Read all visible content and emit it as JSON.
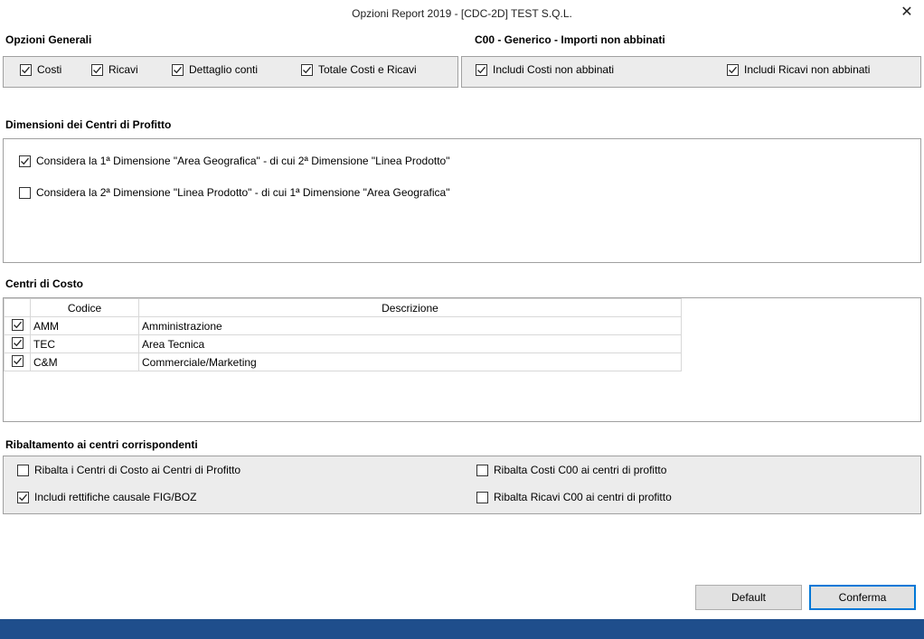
{
  "window": {
    "title": "Opzioni Report 2019 - [CDC-2D] TEST S.Q.L.",
    "close_glyph": "✕"
  },
  "generali": {
    "title": "Opzioni Generali",
    "items": [
      {
        "label": "Costi",
        "checked": true
      },
      {
        "label": "Ricavi",
        "checked": true
      },
      {
        "label": "Dettaglio conti",
        "checked": true
      },
      {
        "label": "Totale Costi e Ricavi",
        "checked": true
      }
    ]
  },
  "c00": {
    "title": "C00 - Generico - Importi non abbinati",
    "items": [
      {
        "label": "Includi Costi non abbinati",
        "checked": true
      },
      {
        "label": "Includi Ricavi non abbinati",
        "checked": true
      }
    ]
  },
  "dimensioni": {
    "title": "Dimensioni dei Centri di Profitto",
    "items": [
      {
        "label": "Considera la 1ª Dimensione \"Area Geografica\" - di cui 2ª Dimensione \"Linea Prodotto\"",
        "checked": true
      },
      {
        "label": "Considera la 2ª Dimensione \"Linea Prodotto\" - di cui 1ª Dimensione \"Area Geografica\"",
        "checked": false
      }
    ]
  },
  "centri": {
    "title": "Centri di Costo",
    "columns": {
      "codice": "Codice",
      "descrizione": "Descrizione"
    },
    "rows": [
      {
        "checked": true,
        "codice": "AMM",
        "descrizione": "Amministrazione"
      },
      {
        "checked": true,
        "codice": "TEC",
        "descrizione": "Area Tecnica"
      },
      {
        "checked": true,
        "codice": "C&M",
        "descrizione": "Commerciale/Marketing"
      }
    ]
  },
  "ribaltamento": {
    "title": "Ribaltamento ai centri corrispondenti",
    "items": [
      {
        "label": "Ribalta i Centri di Costo ai Centri di Profitto",
        "checked": false
      },
      {
        "label": "Ribalta Costi C00 ai centri di profitto",
        "checked": false
      },
      {
        "label": "Includi rettifiche causale FIG/BOZ",
        "checked": true
      },
      {
        "label": "Ribalta Ricavi C00 ai centri di profitto",
        "checked": false
      }
    ]
  },
  "buttons": {
    "default_label": "Default",
    "confirm_label": "Conferma"
  },
  "colors": {
    "footer": "#1f4e8c",
    "panel_gray": "#ececec",
    "primary_border": "#0078d7"
  }
}
